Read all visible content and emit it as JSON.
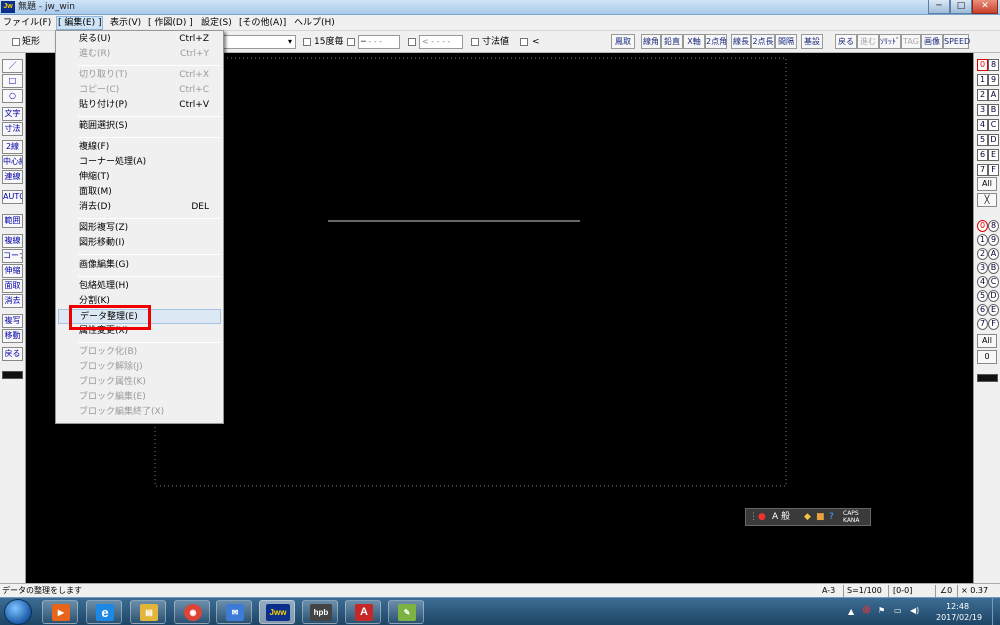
{
  "window": {
    "title": "無題 - jw_win",
    "app_icon": "Jw"
  },
  "menubar": {
    "items": [
      "ファイル(F)",
      "[ 編集(E) ]",
      "表示(V)",
      "[ 作図(D) ]",
      "設定(S)",
      "[その他(A)]",
      "ヘルプ(H)"
    ]
  },
  "toolbar": {
    "rect_label": "矩形",
    "angle_label": "15度毎",
    "input1": "━ - - -",
    "input2": "< - - - -",
    "dim_label": "寸法値",
    "arrow_label": "<",
    "buttons": [
      "鳳取",
      "線角",
      "鉛直",
      "X軸",
      "2点角",
      "線長",
      "2点長",
      "間隔",
      "基設",
      "戻る",
      "進む",
      "ｿﾘｯﾄﾞ",
      "TAG",
      "画像",
      "SPEED"
    ]
  },
  "left_tools": [
    "／",
    "□",
    "○",
    "文字",
    "寸法",
    "2線",
    "中心線",
    "連線",
    "AUTO",
    "範囲",
    "複線",
    "コーナー",
    "伸縮",
    "面取",
    "消去",
    "複写",
    "移動",
    "戻る"
  ],
  "right_tools": {
    "layer_rows": [
      [
        "0",
        "8"
      ],
      [
        "1",
        "9"
      ],
      [
        "2",
        "A"
      ],
      [
        "3",
        "B"
      ],
      [
        "4",
        "C"
      ],
      [
        "5",
        "D"
      ],
      [
        "6",
        "E"
      ],
      [
        "7",
        "F"
      ]
    ],
    "all_label": "All",
    "x_label": "╳",
    "group_rows": [
      [
        "0",
        "8"
      ],
      [
        "1",
        "9"
      ],
      [
        "2",
        "A"
      ],
      [
        "3",
        "B"
      ],
      [
        "4",
        "C"
      ],
      [
        "5",
        "D"
      ],
      [
        "6",
        "E"
      ],
      [
        "7",
        "F"
      ]
    ],
    "all2_label": "All",
    "zero_label": "0"
  },
  "dropdown": {
    "items": [
      {
        "label": "戻る(U)",
        "shortcut": "Ctrl+Z",
        "enabled": true
      },
      {
        "label": "進む(R)",
        "shortcut": "Ctrl+Y",
        "enabled": false
      },
      {
        "label": "切り取り(T)",
        "shortcut": "Ctrl+X",
        "enabled": false
      },
      {
        "label": "コピー(C)",
        "shortcut": "Ctrl+C",
        "enabled": false
      },
      {
        "label": "貼り付け(P)",
        "shortcut": "Ctrl+V",
        "enabled": true
      },
      {
        "label": "範囲選択(S)",
        "shortcut": "",
        "enabled": true
      },
      {
        "label": "複線(F)",
        "shortcut": "",
        "enabled": true
      },
      {
        "label": "コーナー処理(A)",
        "shortcut": "",
        "enabled": true
      },
      {
        "label": "伸縮(T)",
        "shortcut": "",
        "enabled": true
      },
      {
        "label": "面取(M)",
        "shortcut": "",
        "enabled": true
      },
      {
        "label": "消去(D)",
        "shortcut": "DEL",
        "enabled": true
      },
      {
        "label": "図形複写(Z)",
        "shortcut": "",
        "enabled": true
      },
      {
        "label": "図形移動(I)",
        "shortcut": "",
        "enabled": true
      },
      {
        "label": "画像編集(G)",
        "shortcut": "",
        "enabled": true
      },
      {
        "label": "包絡処理(H)",
        "shortcut": "",
        "enabled": true
      },
      {
        "label": "分割(K)",
        "shortcut": "",
        "enabled": true
      },
      {
        "label": "データ整理(E)",
        "shortcut": "",
        "enabled": true,
        "highlighted": true
      },
      {
        "label": "属性変更(X)",
        "shortcut": "",
        "enabled": true
      },
      {
        "label": "ブロック化(B)",
        "shortcut": "",
        "enabled": false
      },
      {
        "label": "ブロック解除(J)",
        "shortcut": "",
        "enabled": false
      },
      {
        "label": "ブロック属性(K)",
        "shortcut": "",
        "enabled": false
      },
      {
        "label": "ブロック編集(E)",
        "shortcut": "",
        "enabled": false
      },
      {
        "label": "ブロック編集終了(X)",
        "shortcut": "",
        "enabled": false
      }
    ]
  },
  "ime": {
    "text": "A 般",
    "caps": "CAPS",
    "kana": "KANA"
  },
  "statusbar": {
    "message": "データの整理をします",
    "paper": "A-3",
    "scale": "S=1/100",
    "layer": "[0-0]",
    "angle": "∠0",
    "zoom": "× 0.37"
  },
  "taskbar": {
    "apps": [
      {
        "name": "media-player",
        "glyph": "▶",
        "color": "#e8641b"
      },
      {
        "name": "internet-explorer",
        "glyph": "e",
        "color": "#1e88e5"
      },
      {
        "name": "file-explorer",
        "glyph": "▤",
        "color": "#e2b43a"
      },
      {
        "name": "chrome",
        "glyph": "◉",
        "color": "#db4437"
      },
      {
        "name": "thunderbird",
        "glyph": "✉",
        "color": "#3d7bd6"
      },
      {
        "name": "jw-win",
        "glyph": "Jww",
        "color": "#0b2f8a"
      },
      {
        "name": "hpb",
        "glyph": "hpb",
        "color": "#444"
      },
      {
        "name": "acrobat",
        "glyph": "A",
        "color": "#c62828"
      },
      {
        "name": "paint",
        "glyph": "✎",
        "color": "#7cb342"
      }
    ],
    "time": "12:48",
    "date": "2017/02/19"
  },
  "colors": {
    "canvas": "#000000",
    "highlight": "#ee0000",
    "menu_bg": "#f0f0f0"
  }
}
